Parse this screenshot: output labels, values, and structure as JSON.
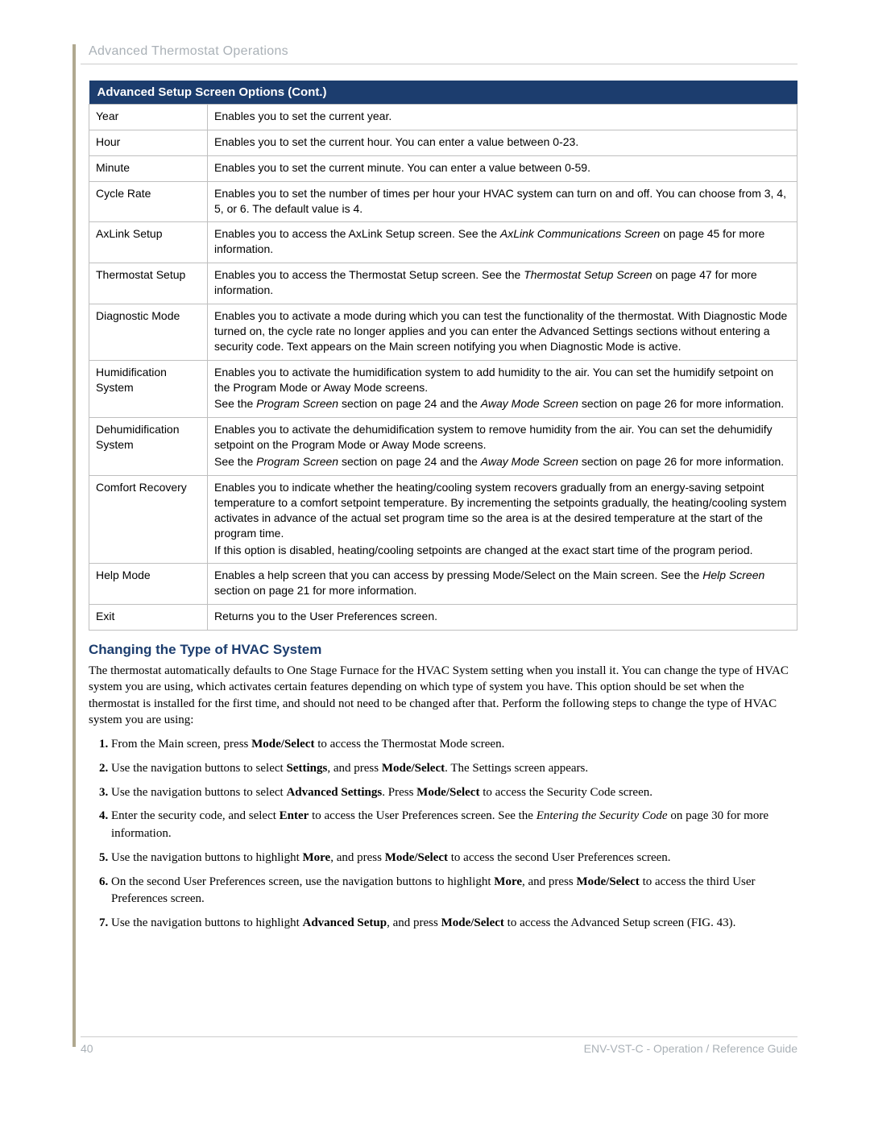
{
  "header": "Advanced Thermostat Operations",
  "table_title": "Advanced Setup Screen Options (Cont.)",
  "rows": [
    {
      "name": "Year",
      "desc": [
        {
          "t": "Enables you to set the current year."
        }
      ]
    },
    {
      "name": "Hour",
      "desc": [
        {
          "t": "Enables you to set the current hour. You can enter a value between 0-23."
        }
      ]
    },
    {
      "name": "Minute",
      "desc": [
        {
          "t": "Enables you to set the current minute. You can enter a value between 0-59."
        }
      ]
    },
    {
      "name": "Cycle Rate",
      "desc": [
        {
          "t": "Enables you to set the number of times per hour your HVAC system can turn on and off. You can choose from 3, 4, 5, or 6. The default value is 4."
        }
      ]
    },
    {
      "name": "AxLink Setup",
      "desc": [
        {
          "parts": [
            {
              "t": "Enables you to access the AxLink Setup screen. See the "
            },
            {
              "t": "AxLink Communications Screen",
              "i": true
            },
            {
              "t": "  on page 45 for more information."
            }
          ]
        }
      ]
    },
    {
      "name": "Thermostat Setup",
      "desc": [
        {
          "parts": [
            {
              "t": "Enables you to access the Thermostat Setup screen. See the "
            },
            {
              "t": "Thermostat Setup Screen",
              "i": true
            },
            {
              "t": "  on page 47 for more information."
            }
          ]
        }
      ]
    },
    {
      "name": "Diagnostic Mode",
      "desc": [
        {
          "t": "Enables you to activate a mode during which you can test the functionality of the thermostat. With Diagnostic Mode turned on, the cycle rate no longer applies and you can enter the Advanced Settings sections without entering a security code. Text appears on the Main screen notifying you when Diagnostic Mode is active."
        }
      ]
    },
    {
      "name": "Humidification System",
      "desc": [
        {
          "t": "Enables you to activate the humidification system to add humidity to the air. You can set the humidify setpoint on the Program Mode or Away Mode screens."
        },
        {
          "parts": [
            {
              "t": "See the "
            },
            {
              "t": "Program Screen",
              "i": true
            },
            {
              "t": " section on page 24 and the "
            },
            {
              "t": "Away Mode Screen",
              "i": true
            },
            {
              "t": " section on page 26 for more information."
            }
          ]
        }
      ]
    },
    {
      "name": "Dehumidification System",
      "desc": [
        {
          "t": "Enables you to activate the dehumidification system to remove humidity from the air. You can set the dehumidify setpoint on the Program Mode or Away Mode screens."
        },
        {
          "parts": [
            {
              "t": "See the "
            },
            {
              "t": "Program Screen",
              "i": true
            },
            {
              "t": " section on page 24 and the "
            },
            {
              "t": "Away Mode Screen",
              "i": true
            },
            {
              "t": " section on page 26 for more information."
            }
          ]
        }
      ]
    },
    {
      "name": "Comfort Recovery",
      "desc": [
        {
          "t": "Enables you to indicate whether the heating/cooling system recovers gradually from an energy-saving setpoint temperature to a comfort setpoint temperature. By incrementing the setpoints gradually, the heating/cooling system activates in advance of the actual set program time so the area is at the desired temperature at the start of the program time."
        },
        {
          "t": "If this option is disabled, heating/cooling setpoints are changed at the exact start time of the program period."
        }
      ]
    },
    {
      "name": "Help Mode",
      "desc": [
        {
          "parts": [
            {
              "t": "Enables a help screen that you can access by pressing Mode/Select on the Main screen. See the "
            },
            {
              "t": "Help Screen",
              "i": true
            },
            {
              "t": " section on page 21 for more information."
            }
          ]
        }
      ]
    },
    {
      "name": "Exit",
      "desc": [
        {
          "t": "Returns you to the User Preferences screen."
        }
      ]
    }
  ],
  "subhead": "Changing the Type of HVAC System",
  "intro": "The thermostat automatically defaults to One Stage Furnace for the HVAC System setting when you install it. You can change the type of HVAC system you are using, which activates certain features depending on which type of system you have. This option should be set when the thermostat is installed for the first time, and should not need to be changed after that. Perform the following steps to change the type of HVAC system you are using:",
  "steps": [
    {
      "parts": [
        {
          "t": "From the Main screen, press "
        },
        {
          "t": "Mode/Select",
          "b": true
        },
        {
          "t": " to access the Thermostat Mode screen."
        }
      ]
    },
    {
      "parts": [
        {
          "t": "Use the navigation buttons to select "
        },
        {
          "t": "Settings",
          "b": true
        },
        {
          "t": ", and press "
        },
        {
          "t": "Mode/Select",
          "b": true
        },
        {
          "t": ". The Settings screen appears."
        }
      ]
    },
    {
      "parts": [
        {
          "t": "Use the navigation buttons to select "
        },
        {
          "t": "Advanced Settings",
          "b": true
        },
        {
          "t": ". Press "
        },
        {
          "t": "Mode/Select",
          "b": true
        },
        {
          "t": " to access the Security Code screen."
        }
      ]
    },
    {
      "parts": [
        {
          "t": "Enter the security code, and select "
        },
        {
          "t": "Enter",
          "b": true
        },
        {
          "t": " to access the User Preferences screen. See the "
        },
        {
          "t": "Entering the Security Code",
          "i": true
        },
        {
          "t": "  on page 30 for more information."
        }
      ]
    },
    {
      "parts": [
        {
          "t": "Use the navigation buttons to highlight "
        },
        {
          "t": "More",
          "b": true
        },
        {
          "t": ", and press "
        },
        {
          "t": "Mode/Select",
          "b": true
        },
        {
          "t": " to access the second User Preferences screen."
        }
      ]
    },
    {
      "parts": [
        {
          "t": "On the second User Preferences screen, use the navigation buttons to highlight "
        },
        {
          "t": "More",
          "b": true
        },
        {
          "t": ", and press "
        },
        {
          "t": "Mode/Select",
          "b": true
        },
        {
          "t": " to access the third User Preferences screen."
        }
      ]
    },
    {
      "parts": [
        {
          "t": "Use the navigation buttons to highlight "
        },
        {
          "t": "Advanced Setup",
          "b": true
        },
        {
          "t": ", and press "
        },
        {
          "t": "Mode/Select",
          "b": true
        },
        {
          "t": " to access the Advanced Setup screen (FIG. 43)."
        }
      ]
    }
  ],
  "footer": {
    "page": "40",
    "doc": "ENV-VST-C - Operation / Reference Guide"
  }
}
